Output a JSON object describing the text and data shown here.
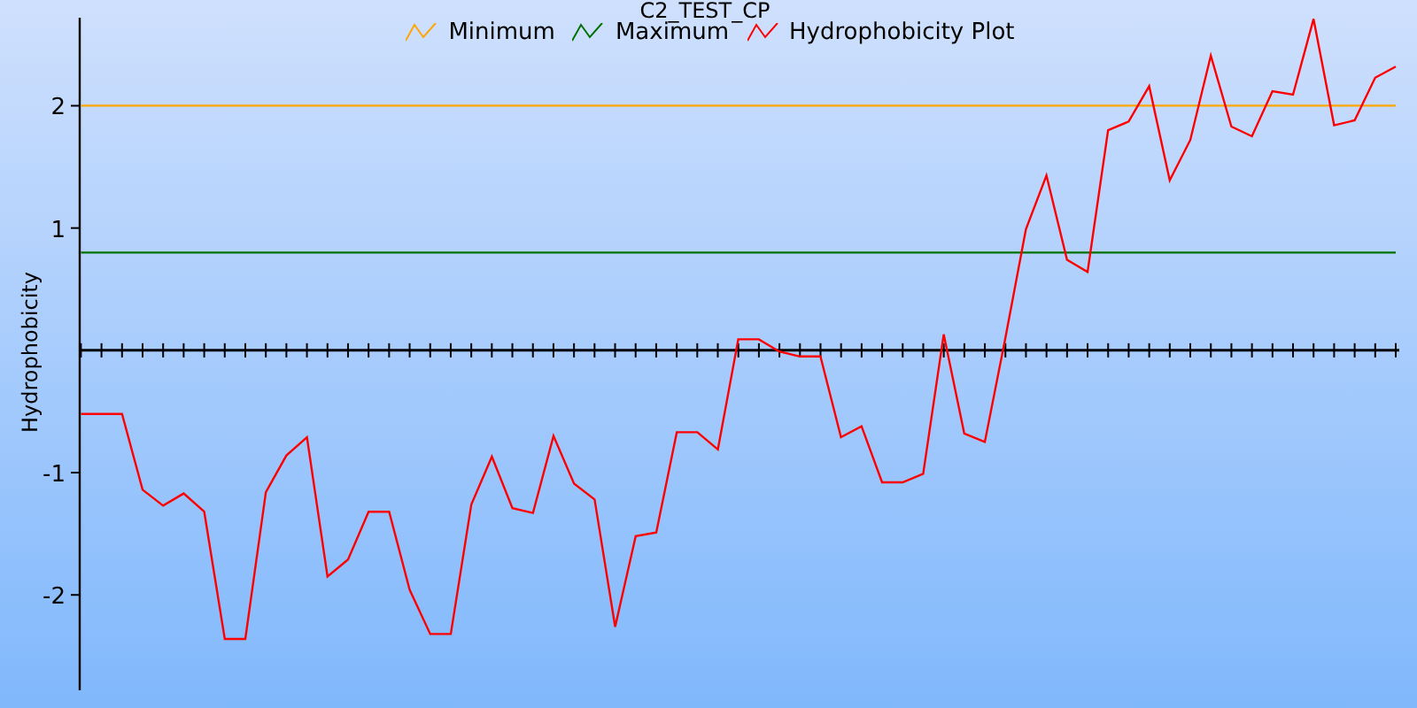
{
  "chart_data": {
    "type": "line",
    "title": "C2_TEST_CP",
    "ylabel": "Hydrophobicity",
    "ylim": [
      -2.78,
      2.72
    ],
    "legend": "top",
    "yticks": [
      -2,
      -1,
      1,
      2
    ],
    "categories": [
      null,
      null,
      null,
      null,
      null,
      null,
      null,
      null,
      null,
      null,
      null,
      null,
      null,
      null,
      null,
      null,
      null,
      null,
      null,
      null,
      null,
      null,
      null,
      null,
      null,
      null,
      null,
      null,
      null,
      null,
      null,
      null,
      null,
      null,
      null,
      null,
      null,
      null,
      null,
      null,
      null,
      null,
      null,
      null,
      null,
      null,
      null,
      null,
      null,
      null,
      null,
      null,
      null,
      null,
      null,
      null,
      null,
      null,
      null,
      null,
      null,
      null,
      null,
      null,
      null
    ],
    "series": [
      {
        "name": "Minimum",
        "color": "#ffa500",
        "values": [
          2,
          2,
          2,
          2,
          2,
          2,
          2,
          2,
          2,
          2,
          2,
          2,
          2,
          2,
          2,
          2,
          2,
          2,
          2,
          2,
          2,
          2,
          2,
          2,
          2,
          2,
          2,
          2,
          2,
          2,
          2,
          2,
          2,
          2,
          2,
          2,
          2,
          2,
          2,
          2,
          2,
          2,
          2,
          2,
          2,
          2,
          2,
          2,
          2,
          2,
          2,
          2,
          2,
          2,
          2,
          2,
          2,
          2,
          2,
          2,
          2,
          2,
          2,
          2,
          2
        ]
      },
      {
        "name": "Maximum",
        "color": "#007000",
        "values": [
          0.8,
          0.8,
          0.8,
          0.8,
          0.8,
          0.8,
          0.8,
          0.8,
          0.8,
          0.8,
          0.8,
          0.8,
          0.8,
          0.8,
          0.8,
          0.8,
          0.8,
          0.8,
          0.8,
          0.8,
          0.8,
          0.8,
          0.8,
          0.8,
          0.8,
          0.8,
          0.8,
          0.8,
          0.8,
          0.8,
          0.8,
          0.8,
          0.8,
          0.8,
          0.8,
          0.8,
          0.8,
          0.8,
          0.8,
          0.8,
          0.8,
          0.8,
          0.8,
          0.8,
          0.8,
          0.8,
          0.8,
          0.8,
          0.8,
          0.8,
          0.8,
          0.8,
          0.8,
          0.8,
          0.8,
          0.8,
          0.8,
          0.8,
          0.8,
          0.8,
          0.8,
          0.8,
          0.8,
          0.8,
          0.8
        ]
      },
      {
        "name": "Hydrophobicity Plot",
        "color": "#ff0000",
        "values": [
          -0.52,
          -0.52,
          -0.52,
          -1.14,
          -1.27,
          -1.17,
          -1.32,
          -2.36,
          -2.36,
          -1.16,
          -0.86,
          -0.71,
          -1.85,
          -1.71,
          -1.32,
          -1.32,
          -1.96,
          -2.32,
          -2.32,
          -1.26,
          -0.87,
          -1.29,
          -1.33,
          -0.7,
          -1.09,
          -1.22,
          -2.26,
          -1.52,
          -1.49,
          -0.67,
          -0.67,
          -0.81,
          0.09,
          0.09,
          -0.01,
          -0.05,
          -0.05,
          -0.71,
          -0.62,
          -1.08,
          -1.08,
          -1.01,
          0.13,
          -0.68,
          -0.75,
          0.1,
          0.99,
          1.43,
          0.74,
          0.64,
          1.8,
          1.87,
          2.16,
          1.39,
          1.72,
          2.41,
          1.83,
          1.75,
          2.12,
          2.09,
          2.71,
          1.84,
          1.88,
          2.23,
          2.32
        ]
      }
    ]
  }
}
